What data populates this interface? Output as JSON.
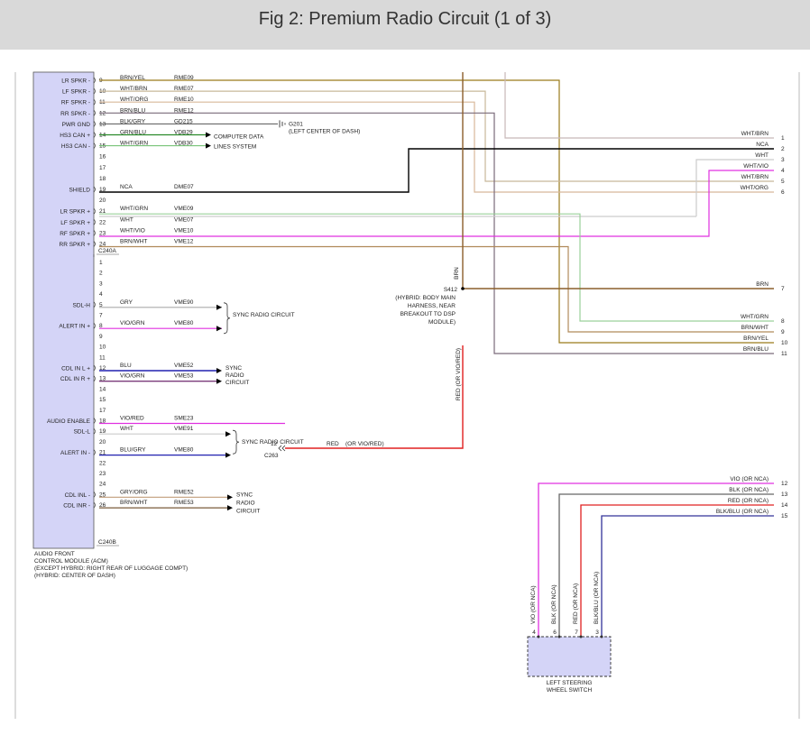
{
  "header": {
    "title": "Fig 2: Premium Radio Circuit (1 of 3)"
  },
  "colors": {
    "header_bg": "#d9d9d9",
    "module_fill": "#d4d4f7",
    "brown": "#8b5e2b",
    "black": "#000000",
    "red": "#e02020",
    "pink": "#e030e0",
    "green": "#2a8a2a",
    "blue": "#2020b0",
    "gray": "#9a9a9a",
    "tan": "#d8b89a",
    "yellow_brown": "#9a7a1a"
  },
  "acm": {
    "connector_a": "C240A",
    "connector_b": "C240B",
    "caption": [
      "AUDIO FRONT",
      "CONTROL MODULE (ACM)",
      "(EXCEPT HYBRID: RIGHT REAR OF LUGGAGE COMPT)",
      "(HYBRID: CENTER OF DASH)"
    ]
  },
  "acm_pins_a": [
    {
      "pin": "9",
      "label": "LR SPKR -",
      "color": "BRN/YEL",
      "circuit": "RME09"
    },
    {
      "pin": "10",
      "label": "LF SPKR -",
      "color": "WHT/BRN",
      "circuit": "RME07"
    },
    {
      "pin": "11",
      "label": "RF SPKR -",
      "color": "WHT/ORG",
      "circuit": "RME10"
    },
    {
      "pin": "12",
      "label": "RR SPKR -",
      "color": "BRN/BLU",
      "circuit": "RME12"
    },
    {
      "pin": "13",
      "label": "PWR GND",
      "color": "BLK/GRY",
      "circuit": "GD215"
    },
    {
      "pin": "14",
      "label": "HS3 CAN +",
      "color": "GRN/BLU",
      "circuit": "VDB29"
    },
    {
      "pin": "15",
      "label": "HS3 CAN -",
      "color": "WHT/GRN",
      "circuit": "VDB30"
    },
    {
      "pin": "16",
      "label": "",
      "color": "",
      "circuit": ""
    },
    {
      "pin": "17",
      "label": "",
      "color": "",
      "circuit": ""
    },
    {
      "pin": "18",
      "label": "",
      "color": "",
      "circuit": ""
    },
    {
      "pin": "19",
      "label": "SHIELD",
      "color": "NCA",
      "circuit": "DME07"
    },
    {
      "pin": "20",
      "label": "",
      "color": "",
      "circuit": ""
    },
    {
      "pin": "21",
      "label": "LR SPKR +",
      "color": "WHT/GRN",
      "circuit": "VME09"
    },
    {
      "pin": "22",
      "label": "LF SPKR +",
      "color": "WHT",
      "circuit": "VME07"
    },
    {
      "pin": "23",
      "label": "RF SPKR +",
      "color": "WHT/VIO",
      "circuit": "VME10"
    },
    {
      "pin": "24",
      "label": "RR SPKR +",
      "color": "BRN/WHT",
      "circuit": "VME12"
    }
  ],
  "acm_pins_b": [
    {
      "pin": "1",
      "label": "",
      "color": "",
      "circuit": ""
    },
    {
      "pin": "2",
      "label": "",
      "color": "",
      "circuit": ""
    },
    {
      "pin": "3",
      "label": "",
      "color": "",
      "circuit": ""
    },
    {
      "pin": "4",
      "label": "",
      "color": "",
      "circuit": ""
    },
    {
      "pin": "5",
      "label": "SDL-H",
      "color": "GRY",
      "circuit": "VME90"
    },
    {
      "pin": "7",
      "label": "",
      "color": "",
      "circuit": ""
    },
    {
      "pin": "8",
      "label": "ALERT IN +",
      "color": "VIO/GRN",
      "circuit": "VME80"
    },
    {
      "pin": "9",
      "label": "",
      "color": "",
      "circuit": ""
    },
    {
      "pin": "10",
      "label": "",
      "color": "",
      "circuit": ""
    },
    {
      "pin": "11",
      "label": "",
      "color": "",
      "circuit": ""
    },
    {
      "pin": "12",
      "label": "CDL IN L +",
      "color": "BLU",
      "circuit": "VME52"
    },
    {
      "pin": "13",
      "label": "CDL IN R +",
      "color": "VIO/GRN",
      "circuit": "VME53"
    },
    {
      "pin": "14",
      "label": "",
      "color": "",
      "circuit": ""
    },
    {
      "pin": "15",
      "label": "",
      "color": "",
      "circuit": ""
    },
    {
      "pin": "17",
      "label": "",
      "color": "",
      "circuit": ""
    },
    {
      "pin": "18",
      "label": "AUDIO ENABLE",
      "color": "VIO/RED",
      "circuit": "SME23"
    },
    {
      "pin": "19",
      "label": "SDL-L",
      "color": "WHT",
      "circuit": "VME91"
    },
    {
      "pin": "20",
      "label": "",
      "color": "",
      "circuit": ""
    },
    {
      "pin": "21",
      "label": "ALERT IN -",
      "color": "BLU/GRY",
      "circuit": "VME80"
    },
    {
      "pin": "22",
      "label": "",
      "color": "",
      "circuit": ""
    },
    {
      "pin": "23",
      "label": "",
      "color": "",
      "circuit": ""
    },
    {
      "pin": "24",
      "label": "",
      "color": "",
      "circuit": ""
    },
    {
      "pin": "25",
      "label": "CDL INL -",
      "color": "GRY/ORG",
      "circuit": "RME52"
    },
    {
      "pin": "26",
      "label": "CDL INR -",
      "color": "BRN/WHT",
      "circuit": "RME53"
    }
  ],
  "labels": {
    "g201": "G201",
    "g201_loc": "(LEFT CENTER OF DASH)",
    "computer_data": [
      "COMPUTER DATA",
      "LINES SYSTEM"
    ],
    "sync_radio_1": "SYNC RADIO CIRCUIT",
    "sync_radio_2": "SYNC RADIO CIRCUIT",
    "sync_cdl_1": [
      "SYNC",
      "RADIO",
      "CIRCUIT"
    ],
    "sync_cdl_2": [
      "SYNC",
      "RADIO",
      "CIRCUIT"
    ],
    "s412": "S412",
    "s412_loc": [
      "(HYBRID: BODY MAIN",
      "HARNESS, NEAR",
      "BREAKOUT TO DSP",
      "MODULE)"
    ],
    "brn_vertical": "BRN",
    "red_vertical": "RED  (OR VIO/RED)",
    "red_horizontal": "RED",
    "red_horizontal_alt": "(OR VIO/RED)",
    "c263": "C263",
    "c263_pin": "12"
  },
  "right_outputs": [
    {
      "num": "1",
      "color": "WHT/BRN"
    },
    {
      "num": "2",
      "color": "NCA"
    },
    {
      "num": "3",
      "color": "WHT"
    },
    {
      "num": "4",
      "color": "WHT/VIO"
    },
    {
      "num": "5",
      "color": "WHT/BRN"
    },
    {
      "num": "6",
      "color": "WHT/ORG"
    },
    {
      "num": "7",
      "color": "BRN"
    },
    {
      "num": "8",
      "color": "WHT/GRN"
    },
    {
      "num": "9",
      "color": "BRN/WHT"
    },
    {
      "num": "10",
      "color": "BRN/YEL"
    },
    {
      "num": "11",
      "color": "BRN/BLU"
    }
  ],
  "switch_outputs": [
    {
      "num": "12",
      "color": "VIO",
      "alt": "(OR NCA)"
    },
    {
      "num": "13",
      "color": "BLK",
      "alt": "(OR NCA)"
    },
    {
      "num": "14",
      "color": "RED",
      "alt": "(OR NCA)"
    },
    {
      "num": "15",
      "color": "BLK/BLU",
      "alt": "(OR NCA)"
    }
  ],
  "switch_pins": [
    {
      "pin": "4",
      "label": "VIO  (OR NCA)"
    },
    {
      "pin": "6",
      "label": "BLK  (OR NCA)"
    },
    {
      "pin": "7",
      "label": "RED  (OR NCA)"
    },
    {
      "pin": "3",
      "label": "BLK/BLU  (OR NCA)"
    }
  ],
  "switch_caption": [
    "LEFT STEERING",
    "WHEEL SWITCH"
  ]
}
